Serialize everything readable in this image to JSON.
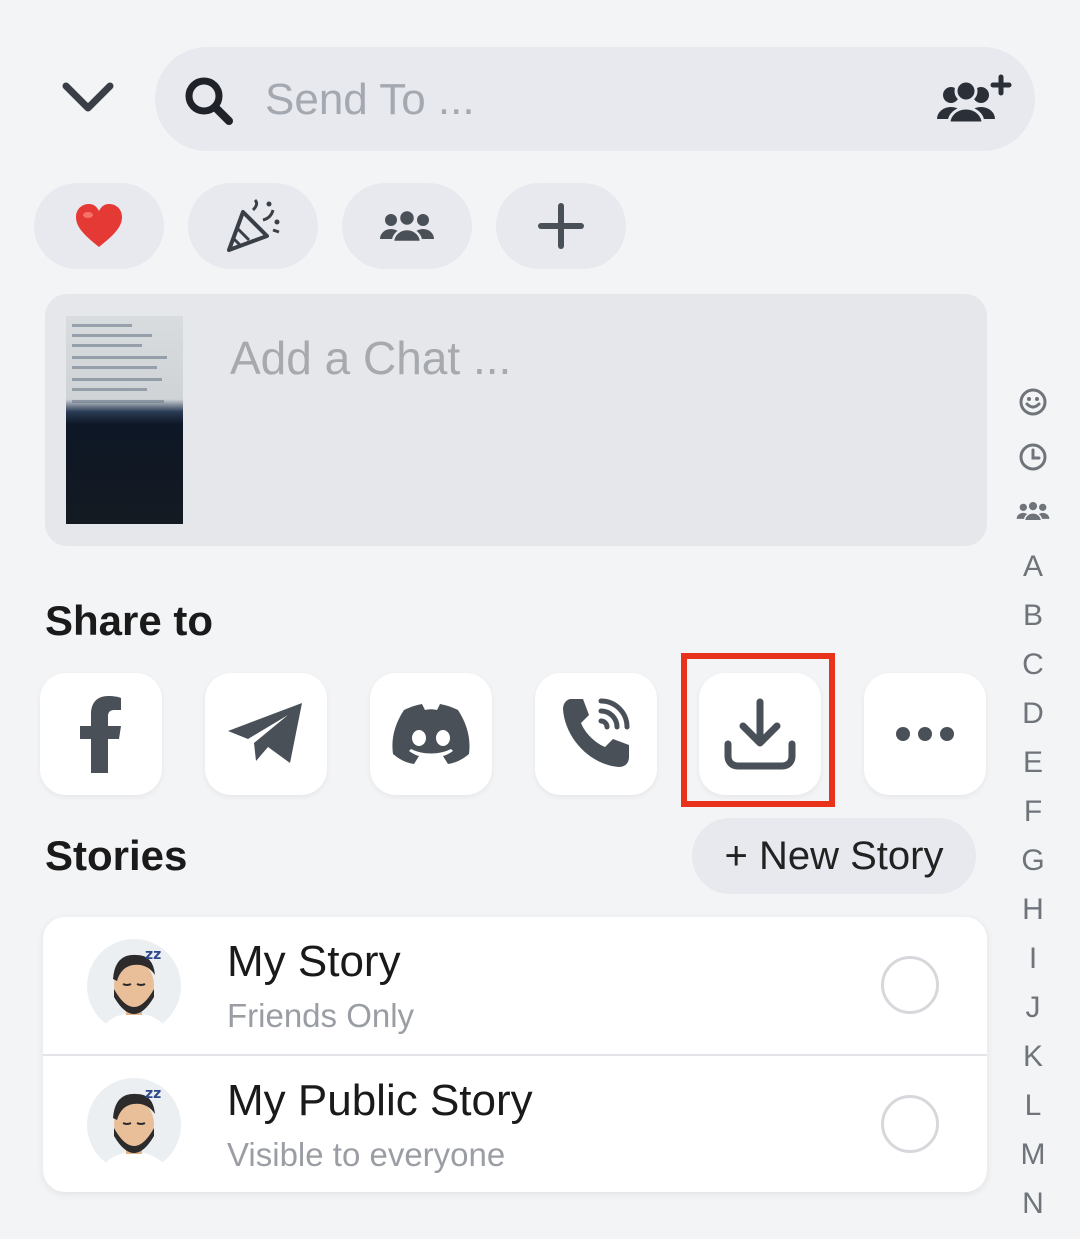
{
  "header": {
    "collapse_icon": "chevron-down-icon",
    "search": {
      "placeholder": "Send To ...",
      "icon": "search-icon",
      "new_group_icon": "new-group-icon"
    }
  },
  "quick_filters": [
    {
      "name": "best-friends",
      "icon": "heart-icon"
    },
    {
      "name": "celebration",
      "icon": "party-popper-icon"
    },
    {
      "name": "groups",
      "icon": "group-icon"
    },
    {
      "name": "add",
      "icon": "plus-icon"
    }
  ],
  "chat": {
    "placeholder": "Add a Chat ..."
  },
  "share": {
    "title": "Share to",
    "apps": [
      {
        "name": "facebook",
        "icon": "facebook-icon"
      },
      {
        "name": "telegram",
        "icon": "telegram-icon"
      },
      {
        "name": "discord",
        "icon": "discord-icon"
      },
      {
        "name": "viber",
        "icon": "viber-icon"
      },
      {
        "name": "save",
        "icon": "download-icon",
        "highlighted": true
      },
      {
        "name": "more",
        "icon": "more-icon"
      }
    ]
  },
  "stories": {
    "title": "Stories",
    "new_story_label": "+ New Story",
    "items": [
      {
        "title": "My Story",
        "subtitle": "Friends Only"
      },
      {
        "title": "My Public Story",
        "subtitle": "Visible to everyone"
      }
    ]
  },
  "alpha_index": {
    "icons": [
      "smiley-icon",
      "clock-icon",
      "group-icon"
    ],
    "letters": [
      "A",
      "B",
      "C",
      "D",
      "E",
      "F",
      "G",
      "H",
      "I",
      "J",
      "K",
      "L",
      "M",
      "N"
    ]
  },
  "colors": {
    "highlight": "#e8321c",
    "background": "#f3f4f6",
    "icon": "#4a5058",
    "heart": "#e53935"
  }
}
